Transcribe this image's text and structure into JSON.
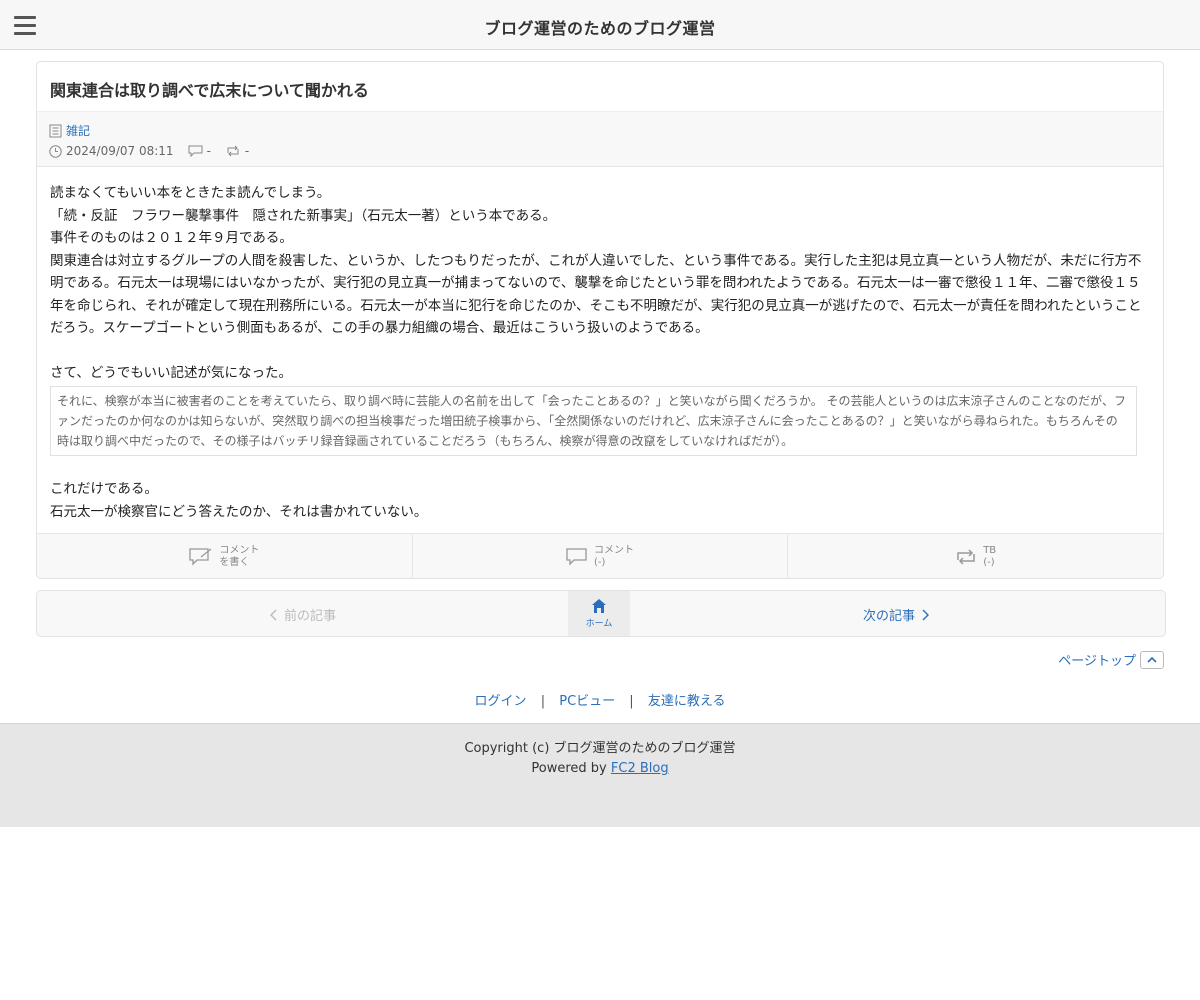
{
  "header": {
    "site_title": "ブログ運営のためのブログ運営",
    "menu_icon": "hamburger-icon"
  },
  "article": {
    "title": "関東連合は取り調べで広末について聞かれる",
    "category": "雑記",
    "date": "2024/09/07 08:11",
    "comment_count": "-",
    "trackback_count": "-",
    "paragraphs": {
      "p1": "読まなくてもいい本をときたま読んでしまう。",
      "p2": "「続・反証　フラワー襲撃事件　隠された新事実」（石元太一著）という本である。",
      "p3": "事件そのものは２０１２年９月である。",
      "p4": "関東連合は対立するグループの人間を殺害した、というか、したつもりだったが、これが人違いでした、という事件である。実行した主犯は見立真一という人物だが、未だに行方不明である。石元太一は現場にはいなかったが、実行犯の見立真一が捕まってないので、襲撃を命じたという罪を問われたようである。石元太一は一審で懲役１１年、二審で懲役１５年を命じられ、それが確定して現在刑務所にいる。石元太一が本当に犯行を命じたのか、そこも不明瞭だが、実行犯の見立真一が逃げたので、石元太一が責任を問われたということだろう。スケープゴートという側面もあるが、この手の暴力組織の場合、最近はこういう扱いのようである。",
      "p5": "さて、どうでもいい記述が気になった。",
      "quote": "それに、検察が本当に被害者のことを考えていたら、取り調べ時に芸能人の名前を出して「会ったことあるの？」と笑いながら聞くだろうか。 その芸能人というのは広末涼子さんのことなのだが、ファンだったのか何なのかは知らないが、突然取り調べの担当検事だった増田統子検事から、「全然関係ないのだけれど、広末涼子さんに会ったことあるの？」と笑いながら尋ねられた。もちろんその時は取り調べ中だったので、その様子はバッチリ録音録画されていることだろう（もちろん、検察が得意の改竄をしていなければだが）。",
      "p6": "これだけである。",
      "p7": "石元太一が検察官にどう答えたのか、それは書かれていない。"
    },
    "actions": {
      "write_comment_1": "コメント",
      "write_comment_2": "を書く",
      "comments_1": "コメント",
      "comments_2": "(-)",
      "tb_1": "TB",
      "tb_2": "(-)"
    }
  },
  "pager": {
    "prev": "前の記事",
    "home": "ホーム",
    "next": "次の記事"
  },
  "pagetop": "ページトップ",
  "links": {
    "login": "ログイン",
    "pc_view": "PCビュー",
    "tell_friend": "友達に教える",
    "separator": "|"
  },
  "footer": {
    "copyright": "Copyright (c) ブログ運営のためのブログ運営",
    "powered_prefix": "Powered by",
    "powered_link": "FC2 Blog"
  },
  "colors": {
    "link": "#2a6ebb",
    "header_bg": "#f7f7f7",
    "footer_bg": "#e6e6e6"
  }
}
